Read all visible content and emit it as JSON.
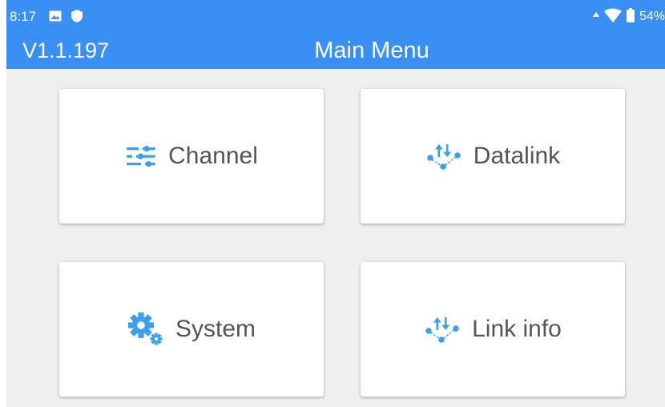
{
  "status_bar": {
    "time": "8:17",
    "battery": "54%",
    "icons": [
      "image-icon",
      "shield-icon",
      "signal-icon",
      "wifi-icon",
      "battery-icon"
    ]
  },
  "header": {
    "version": "V1.1.197",
    "title": "Main Menu"
  },
  "menu": {
    "items": [
      {
        "label": "Channel",
        "icon": "sliders-icon"
      },
      {
        "label": "Datalink",
        "icon": "datalink-icon"
      },
      {
        "label": "System",
        "icon": "gears-icon"
      },
      {
        "label": "Link info",
        "icon": "link-info-icon"
      }
    ]
  },
  "colors": {
    "header": "#3a8ff5",
    "background": "#efefef",
    "tile": "#ffffff",
    "icon": "#3aa0ee",
    "label": "#555555"
  }
}
